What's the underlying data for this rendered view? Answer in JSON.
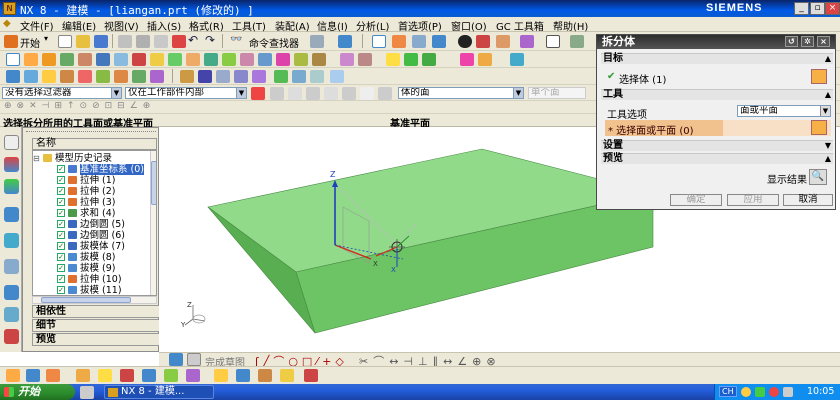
{
  "window": {
    "title": "NX 8 - 建模 - [liangan.prt  (修改的)  ]",
    "brand": "SIEMENS"
  },
  "menu": [
    "文件(F)",
    "编辑(E)",
    "视图(V)",
    "插入(S)",
    "格式(R)",
    "工具(T)",
    "装配(A)",
    "信息(I)",
    "分析(L)",
    "首选项(P)",
    "窗口(O)",
    "GC 工具箱",
    "帮助(H)"
  ],
  "toolbar": {
    "start_label": "开始",
    "command_finder_label": "命令查找器"
  },
  "selection_bar": {
    "filter_value": "没有选择过滤器",
    "scope_value": "仅在工作部件内部",
    "face_rule_value": "体的面",
    "disabled_box_value": "单个面"
  },
  "cue_line": {
    "prompt": "选择拆分所用的工具面或基准平面",
    "status": "基准平面"
  },
  "navigator": {
    "column_header": "名称",
    "items": [
      {
        "label": "模型历史记录",
        "type": "folder"
      },
      {
        "label": "基准坐标系 (0)",
        "type": "datum"
      },
      {
        "label": "拉伸 (1)",
        "type": "extrude"
      },
      {
        "label": "拉伸 (2)",
        "type": "extrude"
      },
      {
        "label": "拉伸 (3)",
        "type": "extrude"
      },
      {
        "label": "求和 (4)",
        "type": "unite"
      },
      {
        "label": "边倒圆 (5)",
        "type": "blend"
      },
      {
        "label": "边倒圆 (6)",
        "type": "blend"
      },
      {
        "label": "拔模体 (7)",
        "type": "draftbody"
      },
      {
        "label": "拔模 (8)",
        "type": "draft"
      },
      {
        "label": "拔模 (9)",
        "type": "draft"
      },
      {
        "label": "拉伸 (10)",
        "type": "extrude"
      },
      {
        "label": "拔模 (11)",
        "type": "draft"
      }
    ],
    "panels": [
      "相依性",
      "细节",
      "预览"
    ]
  },
  "dialog": {
    "title": "拆分体",
    "target_section": "目标",
    "select_body_label": "选择体 (1)",
    "tool_section": "工具",
    "tool_option_label": "工具选项",
    "tool_option_value": "面或平面",
    "select_face_label": "* 选择面或平面 (0)",
    "settings_section": "设置",
    "preview_section": "预览",
    "show_result_label": "显示结果",
    "ok_label": "确定",
    "apply_label": "应用",
    "cancel_label": "取消"
  },
  "bottom_toolbar": {
    "sketch_label": "完成草图"
  },
  "taskbar": {
    "start_label": "开始",
    "task_item": "NX 8 - 建模...",
    "lang": "CH",
    "clock": "10:05"
  },
  "colors": {
    "body_top": "#8fd98a",
    "body_front": "#6cc464",
    "body_side": "#57ad50",
    "accent_select": "#f5c89a",
    "dialog_header": "#3a3a3a"
  }
}
